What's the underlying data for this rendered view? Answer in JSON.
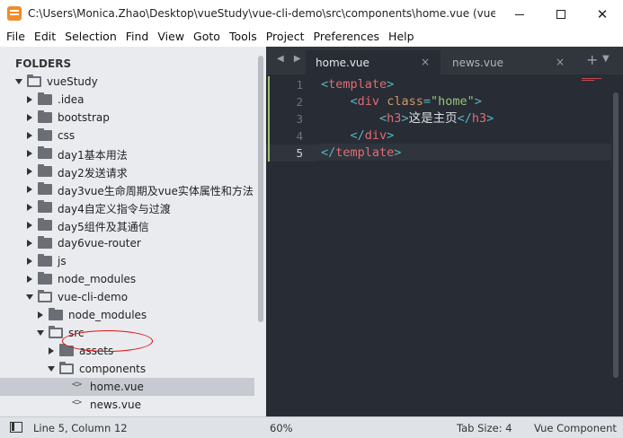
{
  "window": {
    "title": "C:\\Users\\Monica.Zhao\\Desktop\\vueStudy\\vue-cli-demo\\src\\components\\home.vue (vue...",
    "minimize": "—",
    "maximize": "☐",
    "close": "✕"
  },
  "menu": [
    "File",
    "Edit",
    "Selection",
    "Find",
    "View",
    "Goto",
    "Tools",
    "Project",
    "Preferences",
    "Help"
  ],
  "sidebar": {
    "header": "FOLDERS",
    "tree": [
      {
        "label": "vueStudy",
        "depth": 0,
        "type": "folder",
        "expanded": true
      },
      {
        "label": ".idea",
        "depth": 1,
        "type": "folder",
        "expanded": false
      },
      {
        "label": "bootstrap",
        "depth": 1,
        "type": "folder",
        "expanded": false
      },
      {
        "label": "css",
        "depth": 1,
        "type": "folder",
        "expanded": false
      },
      {
        "label": "day1基本用法",
        "depth": 1,
        "type": "folder",
        "expanded": false
      },
      {
        "label": "day2发送请求",
        "depth": 1,
        "type": "folder",
        "expanded": false
      },
      {
        "label": "day3vue生命周期及vue实体属性和方法",
        "depth": 1,
        "type": "folder",
        "expanded": false
      },
      {
        "label": "day4自定义指令与过渡",
        "depth": 1,
        "type": "folder",
        "expanded": false
      },
      {
        "label": "day5组件及其通信",
        "depth": 1,
        "type": "folder",
        "expanded": false
      },
      {
        "label": "day6vue-router",
        "depth": 1,
        "type": "folder",
        "expanded": false
      },
      {
        "label": "js",
        "depth": 1,
        "type": "folder",
        "expanded": false
      },
      {
        "label": "node_modules",
        "depth": 1,
        "type": "folder",
        "expanded": false
      },
      {
        "label": "vue-cli-demo",
        "depth": 1,
        "type": "folder",
        "expanded": true
      },
      {
        "label": "node_modules",
        "depth": 2,
        "type": "folder",
        "expanded": false
      },
      {
        "label": "src",
        "depth": 2,
        "type": "folder",
        "expanded": true
      },
      {
        "label": "assets",
        "depth": 3,
        "type": "folder",
        "expanded": false
      },
      {
        "label": "components",
        "depth": 3,
        "type": "folder",
        "expanded": true
      },
      {
        "label": "home.vue",
        "depth": 4,
        "type": "file",
        "selected": true
      },
      {
        "label": "news.vue",
        "depth": 4,
        "type": "file",
        "selected": false
      }
    ]
  },
  "tabs": [
    {
      "label": "home.vue",
      "active": true
    },
    {
      "label": "news.vue",
      "active": false
    }
  ],
  "tab_close": "×",
  "tab_new": "+",
  "nav_arrows": "◀ ▶",
  "editor": {
    "line_numbers": [
      "1",
      "2",
      "3",
      "4",
      "5"
    ],
    "current_line": 5,
    "lines": [
      [
        {
          "t": "<",
          "c": "bracket"
        },
        {
          "t": "template",
          "c": "tag"
        },
        {
          "t": ">",
          "c": "bracket"
        }
      ],
      [
        {
          "t": "    ",
          "c": "text"
        },
        {
          "t": "<",
          "c": "bracket"
        },
        {
          "t": "div",
          "c": "tag"
        },
        {
          "t": " ",
          "c": "text"
        },
        {
          "t": "class",
          "c": "attr"
        },
        {
          "t": "=",
          "c": "eq"
        },
        {
          "t": "\"home\"",
          "c": "str"
        },
        {
          "t": ">",
          "c": "bracket"
        }
      ],
      [
        {
          "t": "        ",
          "c": "text"
        },
        {
          "t": "<",
          "c": "bracket"
        },
        {
          "t": "h3",
          "c": "tag"
        },
        {
          "t": ">",
          "c": "bracket"
        },
        {
          "t": "这是主页",
          "c": "text"
        },
        {
          "t": "</",
          "c": "bracket"
        },
        {
          "t": "h3",
          "c": "tag"
        },
        {
          "t": ">",
          "c": "bracket"
        }
      ],
      [
        {
          "t": "    ",
          "c": "text"
        },
        {
          "t": "</",
          "c": "bracket"
        },
        {
          "t": "div",
          "c": "tag"
        },
        {
          "t": ">",
          "c": "bracket"
        }
      ],
      [
        {
          "t": "</",
          "c": "bracket"
        },
        {
          "t": "template",
          "c": "tag"
        },
        {
          "t": ">",
          "c": "bracket"
        }
      ]
    ]
  },
  "status": {
    "position": "Line 5, Column 12",
    "zoom": "60%",
    "tab_size": "Tab Size: 4",
    "syntax": "Vue Component"
  },
  "colors": {
    "annotation_circle": "#e01010",
    "editor_bg": "#282c34",
    "sidebar_bg": "#e9ebee"
  }
}
